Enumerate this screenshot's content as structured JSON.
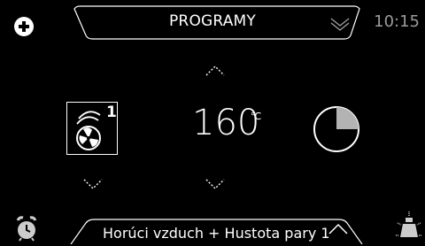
{
  "header": {
    "title": "PROGRAMY",
    "time": "10:15",
    "left_icon": "plus-circle-icon",
    "dropdown_icon": "double-chevron-down-icon"
  },
  "main": {
    "temperature": "160",
    "temperature_unit": "℃",
    "mode_icon": "hot-air-fan-icon",
    "mode_level": "1",
    "timer_icon": "pie-timer-icon",
    "timer_fraction": 0.25
  },
  "footer": {
    "program_label": "Horúci vzduch + Hustota pary 1",
    "left_icon": "alarm-clock-icon",
    "right_icon": "oven-light-icon",
    "expand_icon": "chevron-up-icon"
  },
  "colors": {
    "background": "#000000",
    "foreground": "#ffffff",
    "muted": "#9b9b9b",
    "timer_fill": "#b3b3b3"
  }
}
